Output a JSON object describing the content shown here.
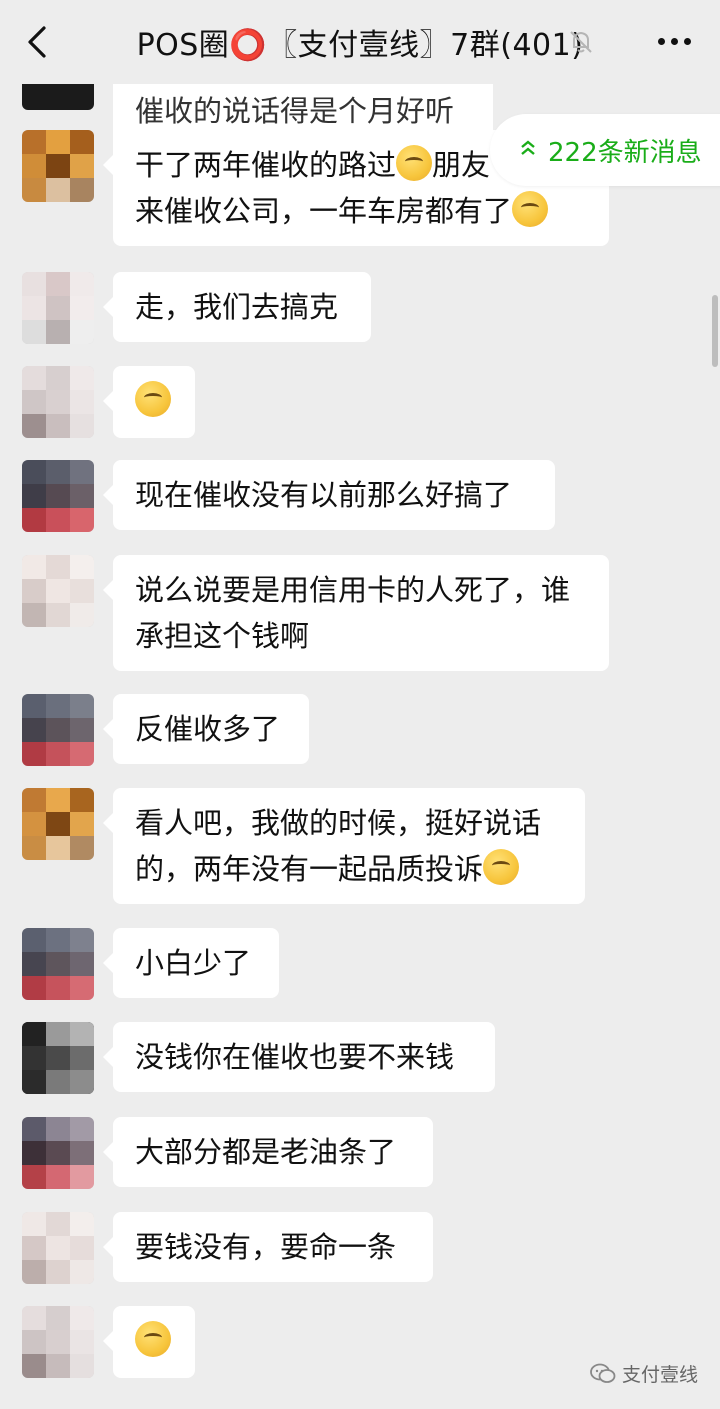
{
  "header": {
    "title": "POS圈⭕〖支付壹线〗7群(401)",
    "back_icon": "back-arrow-icon",
    "mute_icon": "bell-off-icon",
    "more_icon": "more-dots-icon"
  },
  "new_messages": {
    "label": "222条新消息",
    "icon": "double-chevron-up-icon",
    "color": "#1aad19"
  },
  "messages": [
    {
      "text": "催收的说话得是个月好听"
    },
    {
      "text": "干了两年催收的路过",
      "text2": "朋友",
      "text3": "来催收公司，一年车房都有了"
    },
    {
      "text": "走，我们去搞克"
    },
    {
      "text": ""
    },
    {
      "text": "现在催收没有以前那么好搞了"
    },
    {
      "text": "说么说要是用信用卡的人死了，谁\n承担这个钱啊"
    },
    {
      "text": "反催收多了"
    },
    {
      "text": "看人吧，我做的时候，挺好说话\n的，两年没有一起品质投诉"
    },
    {
      "text": "小白少了"
    },
    {
      "text": "没钱你在催收也要不来钱"
    },
    {
      "text": "大部分都是老油条了"
    },
    {
      "text": "要钱没有，要命一条"
    },
    {
      "text": ""
    }
  ],
  "watermark": {
    "label": "支付壹线",
    "icon": "wechat-channel-icon"
  }
}
